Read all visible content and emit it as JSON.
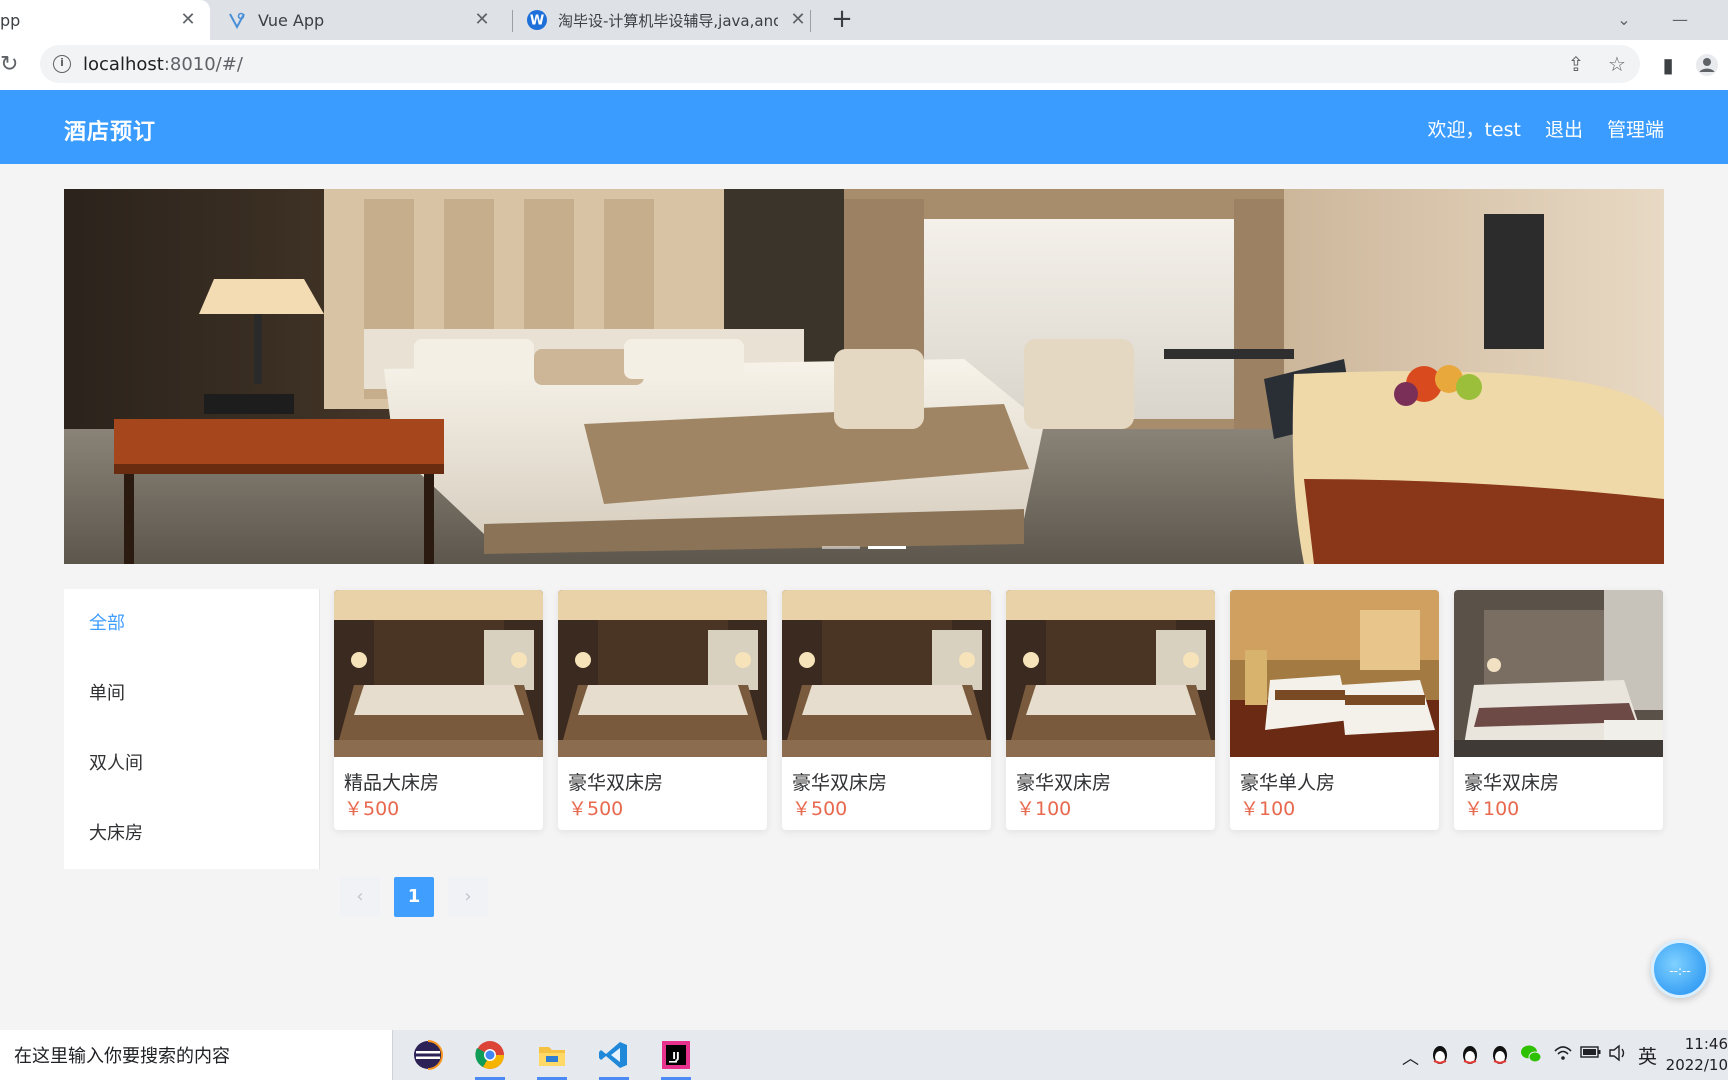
{
  "browser": {
    "tabs": [
      {
        "title": "pp",
        "active": true
      },
      {
        "title": "Vue App",
        "active": false
      },
      {
        "title": "淘毕设-计算机毕设辅导,java,and",
        "active": false
      }
    ],
    "url_host": "localhost",
    "url_rest": ":8010/#/"
  },
  "header": {
    "brand": "酒店预订",
    "welcome": "欢迎，test",
    "logout": "退出",
    "admin": "管理端"
  },
  "carousel": {
    "count": 2,
    "active_index": 1
  },
  "categories": [
    {
      "label": "全部",
      "active": true
    },
    {
      "label": "单间",
      "active": false
    },
    {
      "label": "双人间",
      "active": false
    },
    {
      "label": "大床房",
      "active": false
    }
  ],
  "rooms": [
    {
      "name": "精品大床房",
      "price": "￥500",
      "image": "deluxe-bed"
    },
    {
      "name": "豪华双床房",
      "price": "￥500",
      "image": "deluxe-bed"
    },
    {
      "name": "豪华双床房",
      "price": "￥500",
      "image": "deluxe-bed"
    },
    {
      "name": "豪华双床房",
      "price": "￥100",
      "image": "deluxe-bed"
    },
    {
      "name": "豪华单人房",
      "price": "￥100",
      "image": "twin-bed"
    },
    {
      "name": "豪华双床房",
      "price": "￥100",
      "image": "modern-bed"
    }
  ],
  "pagination": {
    "prev": "‹",
    "current": "1",
    "next": "›"
  },
  "taskbar": {
    "search_placeholder": "在这里输入你要搜索的内容",
    "ime": "英",
    "time": "11:46",
    "date": "2022/10"
  },
  "colors": {
    "header_bg": "#3a9cff",
    "active_menu": "#409eff",
    "price": "#e8694f",
    "page_current": "#409eff"
  }
}
